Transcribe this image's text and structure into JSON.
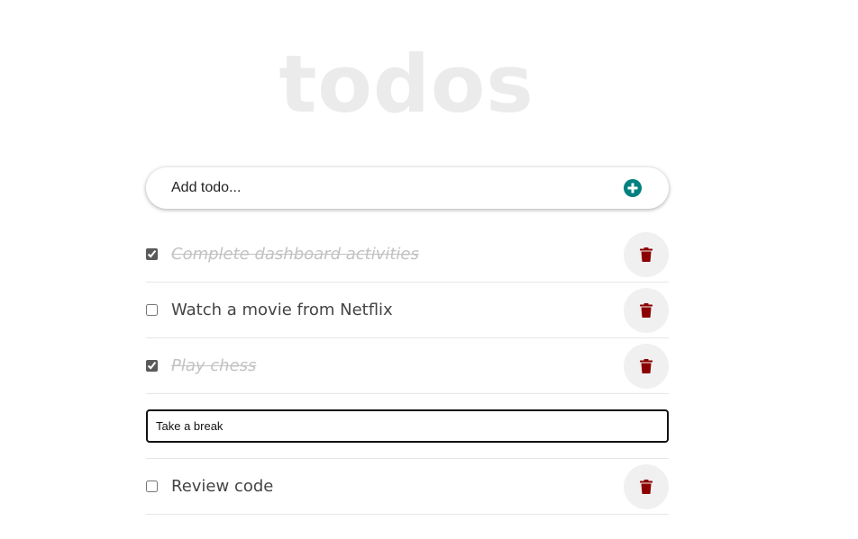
{
  "app": {
    "title": "todos"
  },
  "add_todo": {
    "placeholder": "Add todo...",
    "button_icon": "plus-circle-icon",
    "button_color": "#008080"
  },
  "todos": [
    {
      "text": "Complete dashboard activities",
      "completed": true,
      "editing": false
    },
    {
      "text": "Watch a movie from Netflix",
      "completed": false,
      "editing": false
    },
    {
      "text": "Play chess",
      "completed": true,
      "editing": false
    },
    {
      "text": "Take a break",
      "completed": false,
      "editing": true
    },
    {
      "text": "Review code",
      "completed": false,
      "editing": false
    }
  ],
  "delete_icon": "trash-icon",
  "colors": {
    "delete_icon": "#8b0000",
    "title": "#ebebeb",
    "completed_text": "#c2c2c2"
  }
}
